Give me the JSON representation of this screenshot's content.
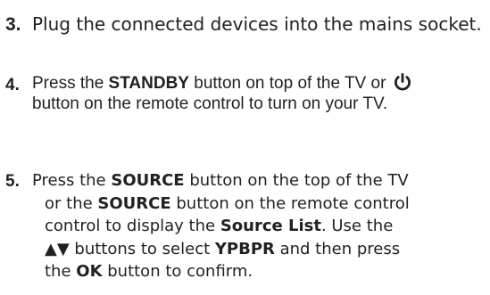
{
  "steps": [
    {
      "number": "3.",
      "lines": [
        [
          "Plug the connected devices into the mains socket."
        ]
      ]
    },
    {
      "number": "4.",
      "lines": [
        [
          "Press the ",
          "STANDBY",
          " button on top of the TV or "
        ],
        [
          "button on the remote control to turn on your TV."
        ]
      ],
      "icon": "power-icon"
    },
    {
      "number": "5.",
      "lines": [
        [
          "Press the ",
          "SOURCE",
          " button on the top  of  the TV"
        ],
        [
          "or the ",
          "SOURCE",
          " button on the remote control"
        ],
        [
          "control to display the ",
          "Source List",
          ". Use the"
        ],
        [
          "▲▼",
          " buttons to select ",
          "YPBPR",
          " and then press"
        ],
        [
          "the ",
          "OK",
          " button to confirm."
        ]
      ]
    }
  ]
}
